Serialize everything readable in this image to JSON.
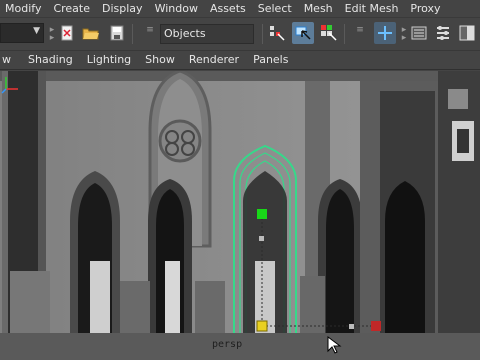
{
  "menubar": {
    "items": [
      "Modify",
      "Create",
      "Display",
      "Window",
      "Assets",
      "Select",
      "Mesh",
      "Edit Mesh",
      "Proxy"
    ]
  },
  "toolbar": {
    "selection_field": "Objects"
  },
  "panel_menu": {
    "items": [
      "w",
      "Shading",
      "Lighting",
      "Show",
      "Renderer",
      "Panels"
    ]
  },
  "viewport": {
    "camera_label": "persp"
  },
  "colors": {
    "selection_outline": "#36d98a",
    "manipulator_green": "#18d818",
    "manipulator_yellow": "#e8d020",
    "manipulator_red": "#c02828"
  }
}
